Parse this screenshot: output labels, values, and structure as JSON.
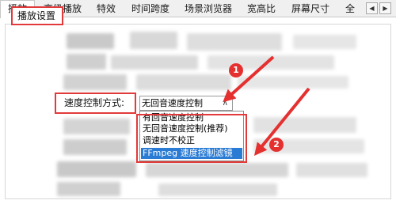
{
  "tabs": [
    {
      "label": "播放",
      "active": true
    },
    {
      "label": "高级播放",
      "active": false
    },
    {
      "label": "特效",
      "active": false
    },
    {
      "label": "时间跨度",
      "active": false
    },
    {
      "label": "场景浏览器",
      "active": false
    },
    {
      "label": "宽高比",
      "active": false
    },
    {
      "label": "屏幕尺寸",
      "active": false
    },
    {
      "label": "全",
      "active": false
    }
  ],
  "tab_scroll": {
    "left": "◀",
    "right": "▶"
  },
  "panel": {
    "group_title": "播放设置",
    "speed_control": {
      "label": "速度控制方式:",
      "value": "无回音速度控制",
      "arrow": "∧",
      "options": [
        "有回音速度控制",
        "无回音速度控制(推荐)",
        "调速时不校正",
        "FFmpeg 速度控制滤镜"
      ],
      "selected_index": 3
    }
  },
  "annotations": {
    "badge_1": "1",
    "badge_2": "2"
  },
  "colors": {
    "highlight_red": "#e23a3a",
    "selection_blue": "#2a7bd4",
    "badge_red": "#e53030"
  }
}
